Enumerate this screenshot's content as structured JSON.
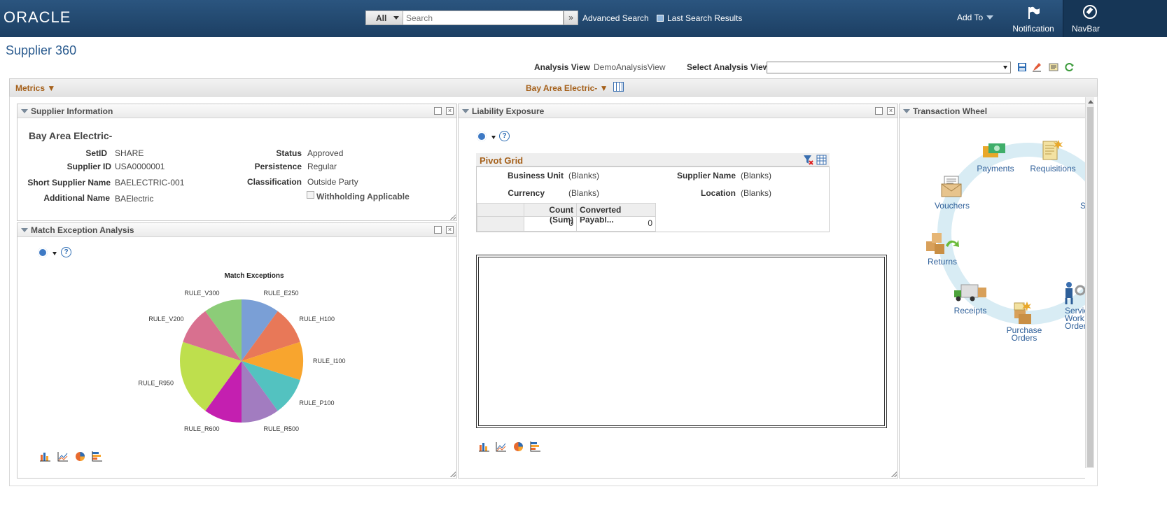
{
  "header": {
    "logo": "ORACLE",
    "search_scope": "All",
    "search_placeholder": "Search",
    "advanced_search": "Advanced Search",
    "last_search_results": "Last Search Results",
    "add_to": "Add To",
    "notification": "Notification",
    "navbar": "NavBar"
  },
  "page": {
    "title": "Supplier 360",
    "analysis_view_label": "Analysis View",
    "analysis_view_value": "DemoAnalysisView",
    "select_analysis_view_label": "Select Analysis View",
    "select_analysis_view_value": ""
  },
  "metrics_bar": {
    "metrics": "Metrics ▼",
    "supplier_selector": "Bay Area Electric- ▼"
  },
  "supplier_info": {
    "title": "Supplier Information",
    "name": "Bay Area Electric-",
    "setid_label": "SetID",
    "setid": "SHARE",
    "supplier_id_label": "Supplier ID",
    "supplier_id": "USA0000001",
    "short_name_label": "Short Supplier Name",
    "short_name": "BAELECTRIC-001",
    "additional_name_label": "Additional Name",
    "additional_name": "BAElectric",
    "status_label": "Status",
    "status": "Approved",
    "persistence_label": "Persistence",
    "persistence": "Regular",
    "classification_label": "Classification",
    "classification": "Outside Party",
    "withholding_label": "Withholding Applicable",
    "withholding_checked": false
  },
  "match_exception": {
    "title": "Match Exception Analysis"
  },
  "chart_data": {
    "type": "pie",
    "title": "Match Exceptions",
    "categories": [
      "RULE_E250",
      "RULE_H100",
      "RULE_I100",
      "RULE_P100",
      "RULE_R500",
      "RULE_R600",
      "RULE_R950",
      "RULE_V200",
      "RULE_V300"
    ],
    "values": [
      1,
      1,
      1,
      1,
      1,
      1,
      2,
      1,
      1
    ],
    "colors": [
      "#7a9fd6",
      "#e87858",
      "#f8a52e",
      "#53c2c0",
      "#a27cc0",
      "#c41fb0",
      "#bedf4d",
      "#d8708f",
      "#8ccc78"
    ]
  },
  "liability": {
    "title": "Liability Exposure",
    "pivot_title": "Pivot Grid",
    "business_unit_label": "Business Unit",
    "business_unit": "(Blanks)",
    "supplier_name_label": "Supplier Name",
    "supplier_name": "(Blanks)",
    "currency_label": "Currency",
    "currency": "(Blanks)",
    "location_label": "Location",
    "location": "(Blanks)",
    "col1": "Count (Sum)",
    "col2": "Converted Payabl...",
    "val1": "0",
    "val2": "0"
  },
  "wheel": {
    "title": "Transaction Wheel",
    "payments": "Payments",
    "requisitions": "Requisitions",
    "vouchers": "Vouchers",
    "returns": "Returns",
    "receipts": "Receipts",
    "purchase_orders": "Purchase Orders",
    "service_work_orders": "Service Work Orders",
    "s_cut": "S"
  }
}
